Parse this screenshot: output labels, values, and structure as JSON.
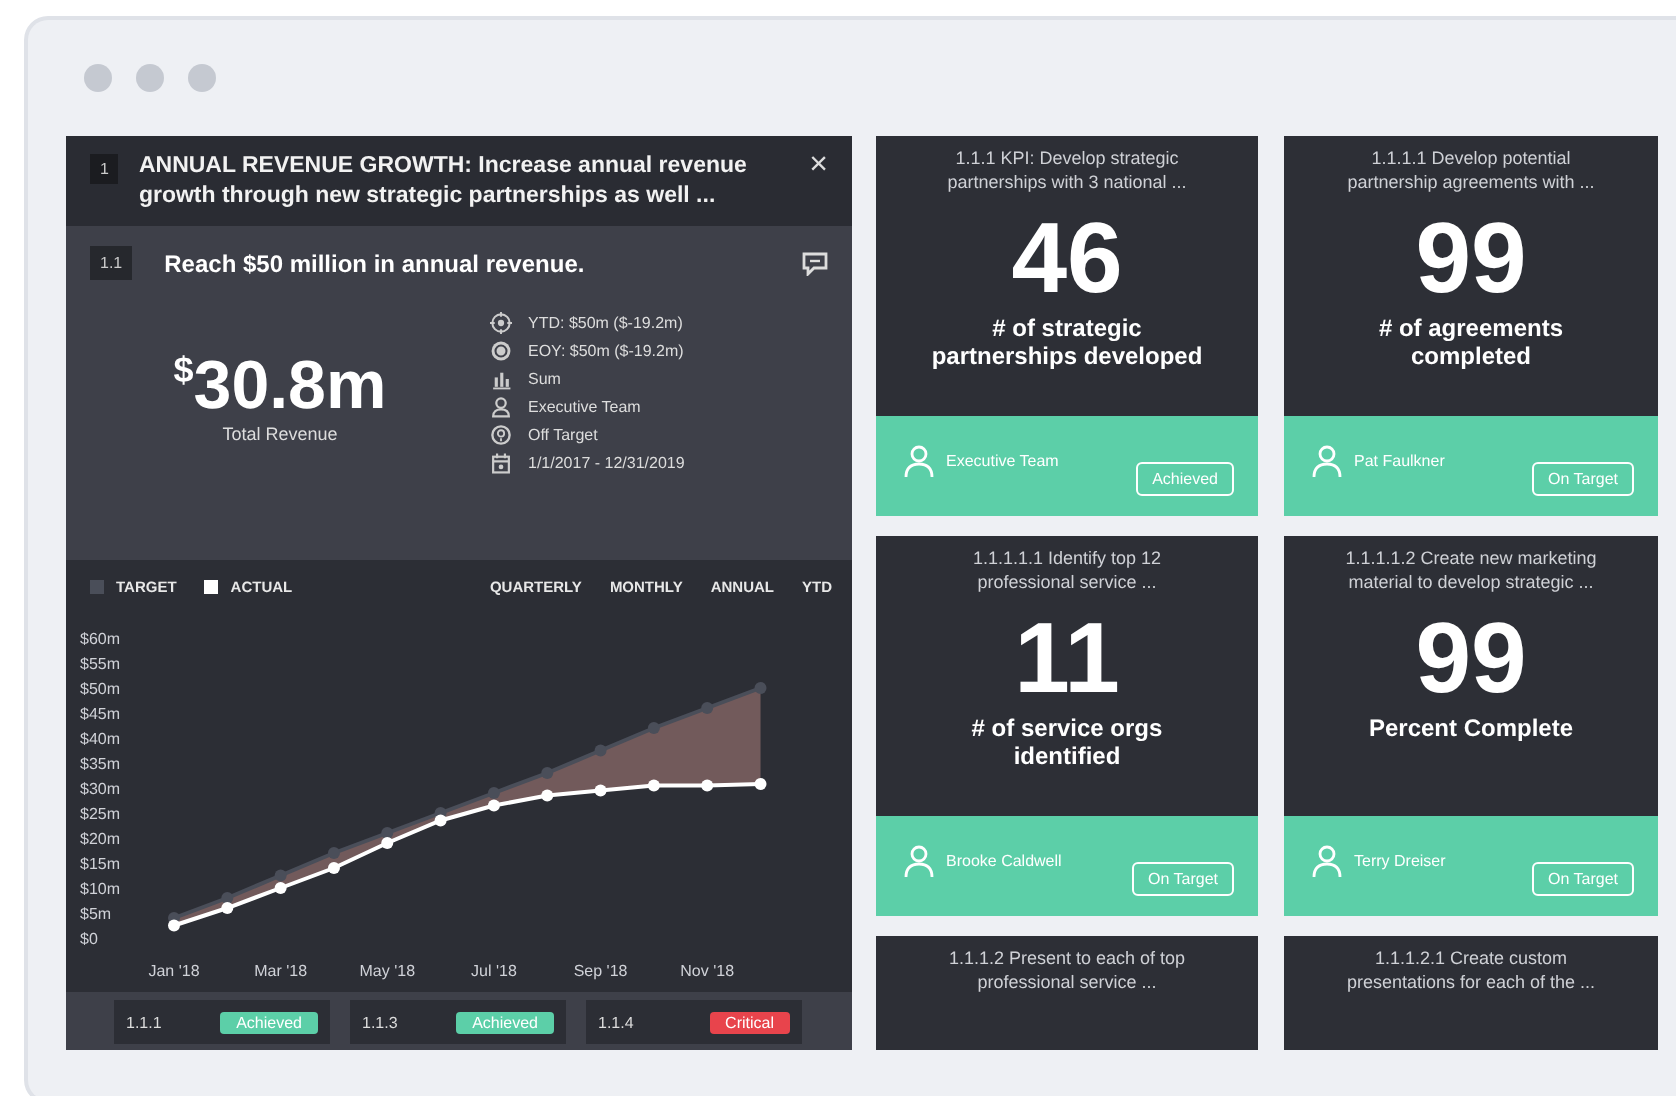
{
  "goal": {
    "number": "1",
    "title": "ANNUAL REVENUE GROWTH: Increase annual revenue growth through new strategic partnerships as well ...",
    "close": "×",
    "objective": {
      "number": "1.1",
      "title": "Reach $50 million in annual revenue.",
      "value": "$^{$}$30.8m",
      "value_label": "Total Revenue",
      "details": [
        {
          "kind": "target",
          "text": "YTD: $50m ($-19.2m)"
        },
        {
          "kind": "goal",
          "text": "EOY: $50m ($-19.2m)"
        },
        {
          "kind": "bars",
          "text": "Sum"
        },
        {
          "kind": "person",
          "text": "Executive Team"
        },
        {
          "kind": "status",
          "text": "Off Target"
        },
        {
          "kind": "calendar",
          "text": "1/1/2017 - 12/31/2019"
        }
      ]
    },
    "periods": [
      {
        "label": "QUARTERLY",
        "selected": false
      },
      {
        "label": "MONTHLY",
        "selected": false
      },
      {
        "label": "ANNUAL",
        "selected": false
      },
      {
        "label": "YTD",
        "selected": false
      }
    ],
    "chart_data": {
      "type": "area",
      "categories": [
        "Jan '18",
        null,
        "Mar '18",
        null,
        "May '18",
        null,
        "Jul '18",
        null,
        "Sep '18",
        null,
        "Nov '18",
        null
      ],
      "series": [
        {
          "name": "TARGET",
          "type": "area",
          "marker": true,
          "color": "#4a4e59",
          "values": [
            4,
            8,
            12.5,
            17,
            21,
            25,
            29,
            33,
            37.5,
            42,
            46,
            50
          ]
        },
        {
          "name": "ACTUAL",
          "type": "line",
          "marker": true,
          "color": "#ffffff",
          "values": [
            2.5,
            6,
            10,
            14,
            19,
            23.5,
            26.5,
            28.5,
            29.5,
            30.5,
            30.5,
            30.8
          ]
        }
      ],
      "ylim": [
        0,
        60
      ],
      "yticks": [
        {
          "value": 0,
          "label": "$0"
        },
        {
          "value": 5,
          "label": "$5m"
        },
        {
          "value": 10,
          "label": "$10m"
        },
        {
          "value": 15,
          "label": "$15m"
        },
        {
          "value": 20,
          "label": "$20m"
        },
        {
          "value": 25,
          "label": "$25m"
        },
        {
          "value": 30,
          "label": "$30m"
        },
        {
          "value": 35,
          "label": "$35m"
        },
        {
          "value": 40,
          "label": "$40m"
        },
        {
          "value": 45,
          "label": "$45m"
        },
        {
          "value": 50,
          "label": "$50m"
        },
        {
          "value": 55,
          "label": "$55m"
        },
        {
          "value": 60,
          "label": "$60m"
        }
      ]
    },
    "sub_items": [
      {
        "number": "1.1.1",
        "status": "Achieved",
        "color": "#5ccfa8"
      },
      {
        "number": "1.1.3",
        "status": "Achieved",
        "color": "#5ccfa8"
      },
      {
        "number": "1.1.4",
        "status": "Critical",
        "color": "#e8444c"
      }
    ]
  },
  "cards": [
    {
      "title": "1.1.1 KPI: Develop strategic partnerships with 3 national ...",
      "value": "46",
      "label": "# of strategic partnerships developed",
      "owner": "Executive Team",
      "status": "Achieved"
    },
    {
      "title": "1.1.1.1 Develop potential partnership agreements with ...",
      "value": "99",
      "label": "# of agreements completed",
      "owner": "Pat Faulkner",
      "status": "On Target"
    },
    {
      "title": "1.1.1.1.1 Identify top 12 professional service ...",
      "value": "11",
      "label": "# of service orgs identified",
      "owner": "Brooke Caldwell",
      "status": "On Target"
    },
    {
      "title": "1.1.1.1.2 Create new marketing material to develop strategic ...",
      "value": "99",
      "label": "Percent Complete",
      "owner": "Terry Dreiser",
      "status": "On Target"
    },
    {
      "title": "1.1.1.2 Present to each of top professional service ..."
    },
    {
      "title": "1.1.1.2.1 Create custom presentations for each of the ..."
    }
  ]
}
